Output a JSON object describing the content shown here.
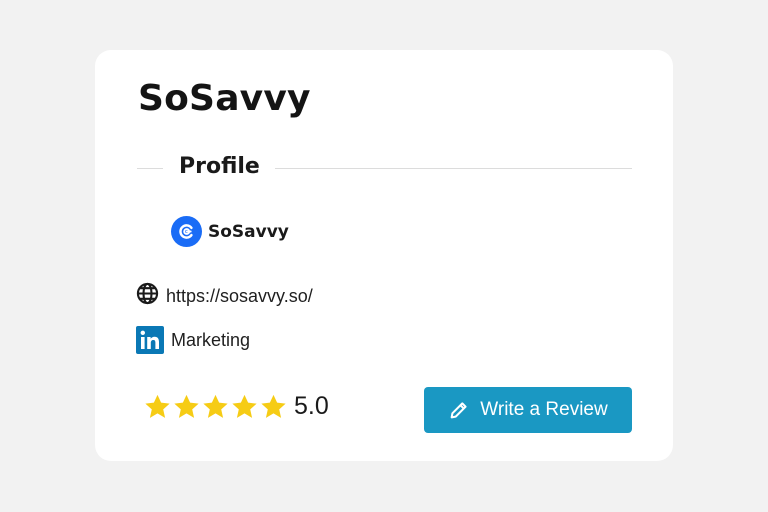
{
  "card": {
    "title": "SoSavvy",
    "section_label": "Profile",
    "brand": {
      "name": "SoSavvy",
      "logo_icon": "sosavvy-logo-icon",
      "logo_color": "#1a6cf6"
    },
    "website": {
      "icon": "globe-icon",
      "url": "https://sosavvy.so/"
    },
    "linkedin": {
      "icon": "linkedin-icon",
      "label": "Marketing",
      "color": "#0a78b5"
    },
    "rating": {
      "stars": 5,
      "max_stars": 5,
      "value": "5.0",
      "star_color": "#f6cc15"
    },
    "review_button": {
      "label": "Write a Review",
      "icon": "pencil-icon",
      "color": "#1a98c3"
    }
  }
}
